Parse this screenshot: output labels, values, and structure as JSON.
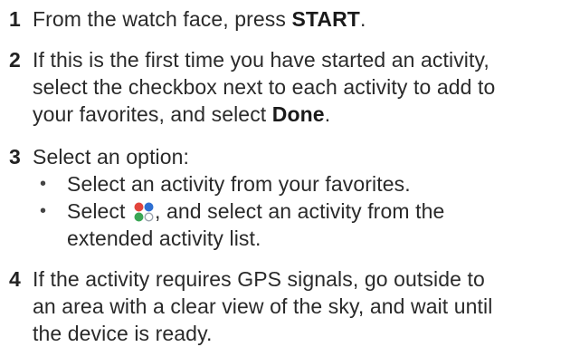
{
  "top_fragment": "",
  "steps": [
    {
      "number": "1",
      "lines": [
        {
          "pre": "From the watch face, press ",
          "bold": "START",
          "post": "."
        }
      ]
    },
    {
      "number": "2",
      "lines": [
        {
          "pre": "If this is the first time you have started an activity,"
        },
        {
          "pre": "select the checkbox next to each activity to add to"
        },
        {
          "pre": "your favorites, and select ",
          "bold": "Done",
          "post": "."
        }
      ]
    },
    {
      "number": "3",
      "lines": [
        {
          "pre": "Select an option:"
        }
      ],
      "bullets": [
        {
          "lines": [
            "Select an activity from your favorites."
          ]
        },
        {
          "pre": "Select ",
          "icon": "activity-list-icon",
          "post": ", and select an activity from the",
          "line2": "extended activity list."
        }
      ]
    },
    {
      "number": "4",
      "lines": [
        {
          "pre": "If the activity requires GPS signals, go outside to"
        },
        {
          "pre": "an area with a clear view of the sky, and wait until"
        },
        {
          "pre": "the device is ready."
        }
      ]
    }
  ],
  "colors": {
    "icon_red": "#e2453c",
    "icon_blue": "#2e6fd1",
    "icon_green": "#3aa655",
    "icon_outline": "#9aa3ad"
  }
}
